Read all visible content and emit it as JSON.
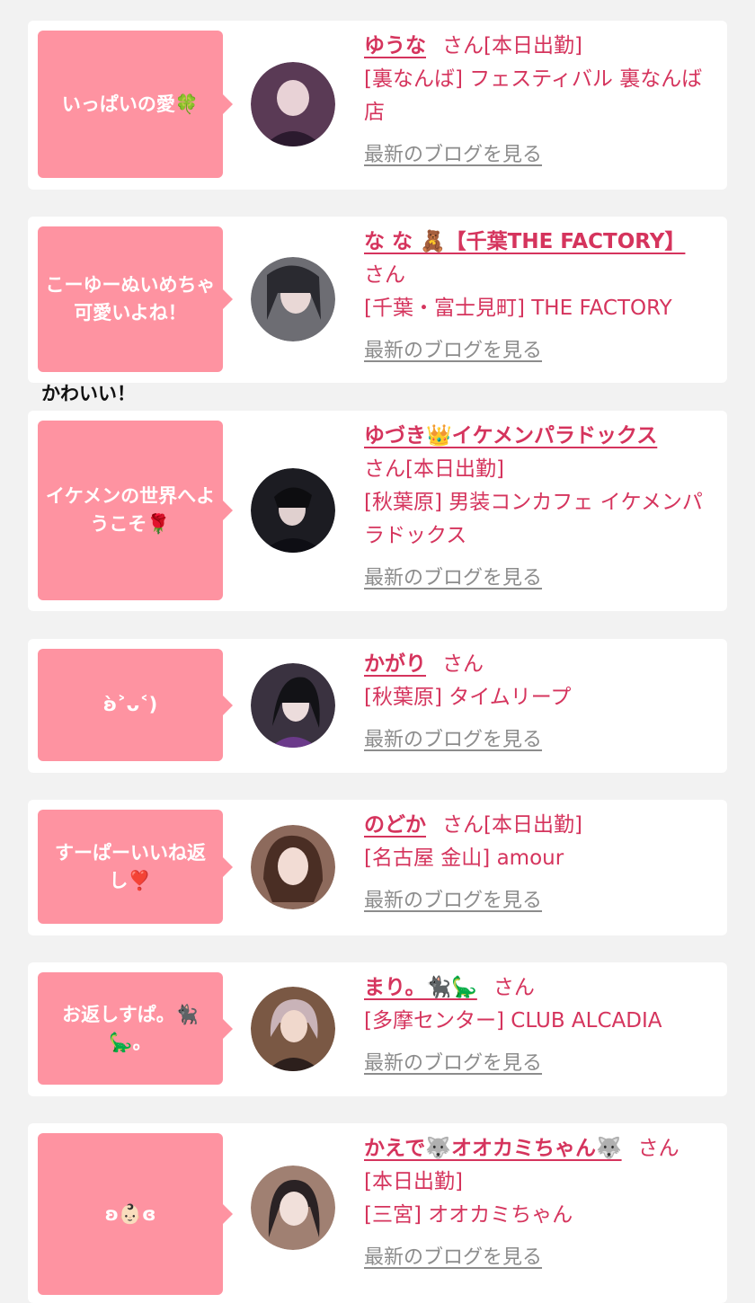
{
  "cards": [
    {
      "message": "いっぱいの愛🍀",
      "name": "ゆうな",
      "honorific": "さん",
      "attendance": "[本日出勤]",
      "shop": "[裏なんば] フェスティバル 裏なんば店",
      "blog_link": "最新のブログを見る",
      "avatar_color": "#5a3a55"
    },
    {
      "message": "こーゆーぬいめちゃ可愛いよね！",
      "name": "な な 🧸【千葉THE FACTORY】",
      "honorific": "さん",
      "attendance": "",
      "shop": "[千葉・富士見町] THE FACTORY",
      "blog_link": "最新のブログを見る",
      "avatar_color": "#6d6d73"
    },
    {
      "message": "イケメンの世界へようこそ🌹",
      "name": "ゆづき👑イケメンパラドックス",
      "honorific": "さん",
      "attendance": "[本日出勤]",
      "shop": "[秋葉原] 男装コンカフェ イケメンパラドックス",
      "blog_link": "最新のブログを見る",
      "avatar_color": "#1c1c22"
    },
    {
      "message": "ʚ̀˃ᴗ˂)",
      "name": "かがり",
      "honorific": "さん",
      "attendance": "",
      "shop": "[秋葉原] タイムリープ",
      "blog_link": "最新のブログを見る",
      "avatar_color": "#3a3240"
    },
    {
      "message": "すーぱーいいね返し❣️",
      "name": "のどか",
      "honorific": "さん",
      "attendance": "[本日出勤]",
      "shop": "[名古屋 金山] amour",
      "blog_link": "最新のブログを見る",
      "avatar_color": "#8d6a5c"
    },
    {
      "message": "お返しすぱ。🐈‍⬛🦕。",
      "name": "まり。🐈‍⬛🦕",
      "honorific": "さん",
      "attendance": "",
      "shop": "[多摩センター] CLUB ALCADIA",
      "blog_link": "最新のブログを見る",
      "avatar_color": "#7a5844"
    },
    {
      "message": "ʚ👶🏻ɞ",
      "name": "かえで🐺オオカミちゃん🐺",
      "honorific": "さん",
      "attendance": "[本日出勤]",
      "shop": "[三宮] オオカミちゃん",
      "blog_link": "最新のブログを見る",
      "avatar_color": "#a08072"
    }
  ],
  "note": "かわいい！"
}
